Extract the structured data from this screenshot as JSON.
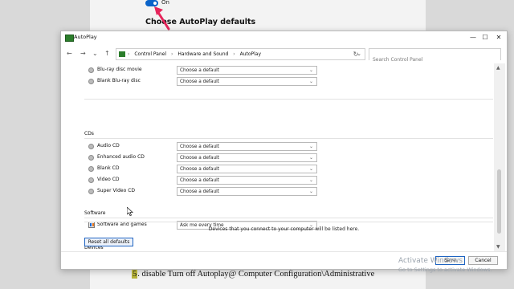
{
  "background": {
    "toggle_label": "On",
    "heading": "Choose AutoPlay defaults",
    "accent_color": "#0a63c9",
    "arrow_color": "#e5245a"
  },
  "window": {
    "title": "AutoPlay",
    "controls": {
      "minimize": "—",
      "maximize": "☐",
      "close": "✕"
    }
  },
  "address": {
    "back": "←",
    "forward": "→",
    "history": "⌄",
    "up": "↑",
    "breadcrumbs": [
      "Control Panel",
      "Hardware and Sound",
      "AutoPlay"
    ],
    "separator": "›",
    "dropdown": "⌄",
    "refresh": "↻",
    "search_placeholder": "Search Control Panel"
  },
  "content": {
    "top_rows": [
      {
        "label": "Blu-ray disc movie",
        "value": "Choose a default"
      },
      {
        "label": "Blank Blu-ray disc",
        "value": "Choose a default"
      }
    ],
    "cds_heading": "CDs",
    "cd_rows": [
      {
        "label": "Audio CD",
        "value": "Choose a default"
      },
      {
        "label": "Enhanced audio CD",
        "value": "Choose a default"
      },
      {
        "label": "Blank CD",
        "value": "Choose a default"
      },
      {
        "label": "Video CD",
        "value": "Choose a default"
      },
      {
        "label": "Super Video CD",
        "value": "Choose a default"
      }
    ],
    "software_heading": "Software",
    "software_rows": [
      {
        "label": "Software and games",
        "value": "Ask me every time"
      }
    ],
    "devices_heading": "Devices",
    "devices_message": "Devices that you connect to your computer will be listed here.",
    "reset_button": "Reset all defaults",
    "caret": "⌄"
  },
  "footer": {
    "save": "Save",
    "cancel": "Cancel"
  },
  "caption": {
    "number": "5",
    "text": ". disable Turn off Autoplay@ Computer Configuration\\Administrative"
  },
  "watermark": {
    "line1": "Activate Windows",
    "line2": "Go to Settings to activate Windows."
  }
}
